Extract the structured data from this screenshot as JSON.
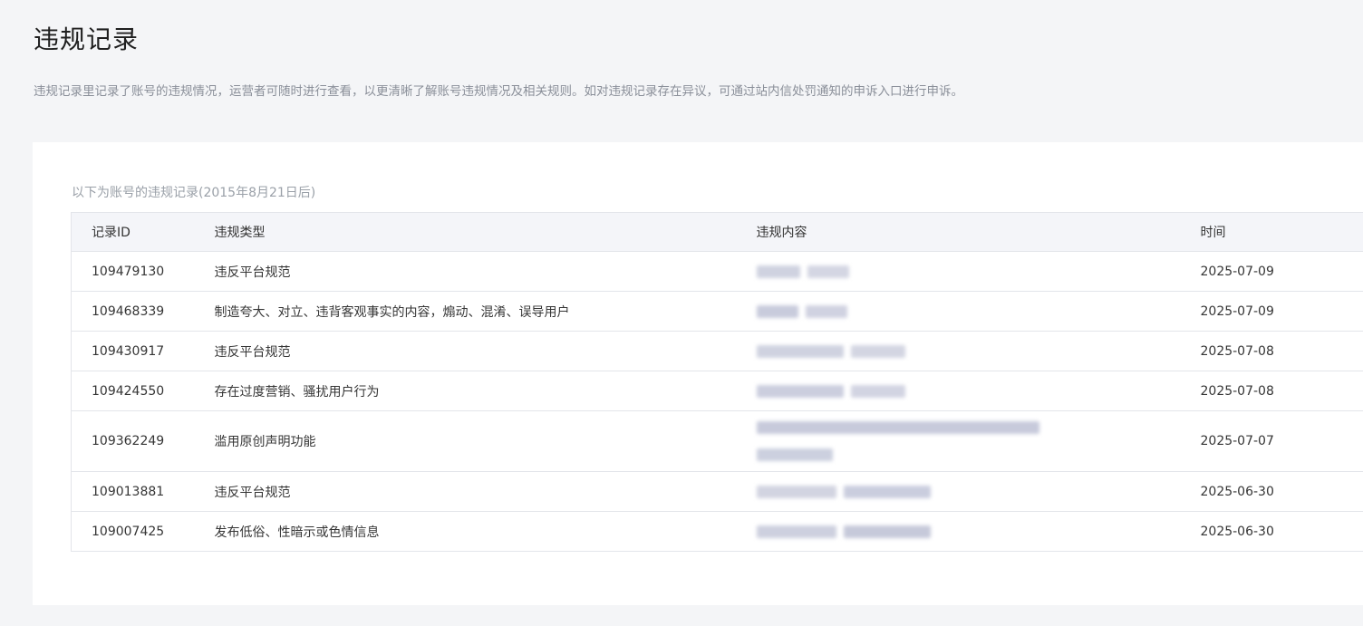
{
  "page": {
    "title": "违规记录",
    "description": "违规记录里记录了账号的违规情况，运营者可随时进行查看，以更清晰了解账号违规情况及相关规则。如对违规记录存在异议，可通过站内信处罚通知的申诉入口进行申诉。"
  },
  "records": {
    "caption": "以下为账号的违规记录(2015年8月21日后)",
    "columns": {
      "id": "记录ID",
      "type": "违规类型",
      "content": "违规内容",
      "time": "时间"
    },
    "rows": [
      {
        "id": "109479130",
        "type": "违反平台规范",
        "content": "",
        "time": "2025-07-09"
      },
      {
        "id": "109468339",
        "type": "制造夸大、对立、违背客观事实的内容，煽动、混淆、误导用户",
        "content": "",
        "time": "2025-07-09"
      },
      {
        "id": "109430917",
        "type": "违反平台规范",
        "content": "",
        "time": "2025-07-08"
      },
      {
        "id": "109424550",
        "type": "存在过度营销、骚扰用户行为",
        "content": "",
        "time": "2025-07-08"
      },
      {
        "id": "109362249",
        "type": "滥用原创声明功能",
        "content": "",
        "time": "2025-07-07"
      },
      {
        "id": "109013881",
        "type": "违反平台规范",
        "content": "",
        "time": "2025-06-30"
      },
      {
        "id": "109007425",
        "type": "发布低俗、性暗示或色情信息",
        "content": "",
        "time": "2025-06-30"
      }
    ],
    "blur_color": "#c5c8d8"
  }
}
